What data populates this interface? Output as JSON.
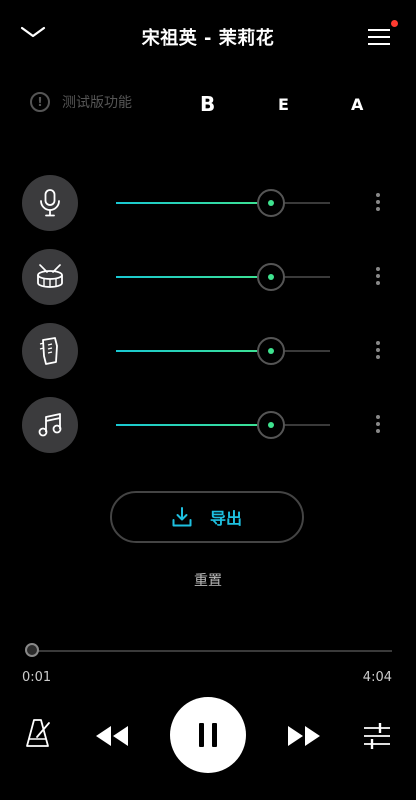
{
  "header": {
    "title": "宋祖英 - 茉莉花",
    "back_icon": "chevron-down-icon",
    "menu_icon": "hamburger-menu-icon",
    "notification_dot_color": "#ff3b30"
  },
  "beta": {
    "label": "测试版功能",
    "icon": "exclamation-circle-icon"
  },
  "modes": [
    "B",
    "E",
    "A"
  ],
  "tracks": [
    {
      "icon": "microphone-icon",
      "level": 0.72
    },
    {
      "icon": "drum-icon",
      "level": 0.72
    },
    {
      "icon": "guitar-icon",
      "level": 0.72
    },
    {
      "icon": "music-note-icon",
      "level": 0.72
    }
  ],
  "export": {
    "label": "导出",
    "icon": "download-icon",
    "color": "#1ec0e0"
  },
  "reset": {
    "label": "重置"
  },
  "playback": {
    "current_time": "0:01",
    "total_time": "4:04",
    "progress": 0.004
  },
  "controls": {
    "metronome_icon": "metronome-icon",
    "rewind_icon": "rewind-icon",
    "pause_icon": "pause-icon",
    "forward_icon": "fast-forward-icon",
    "mixer_icon": "mixer-settings-icon"
  },
  "colors": {
    "accent_start": "#19c8d3",
    "accent_end": "#3fe38f",
    "background": "#000000"
  }
}
